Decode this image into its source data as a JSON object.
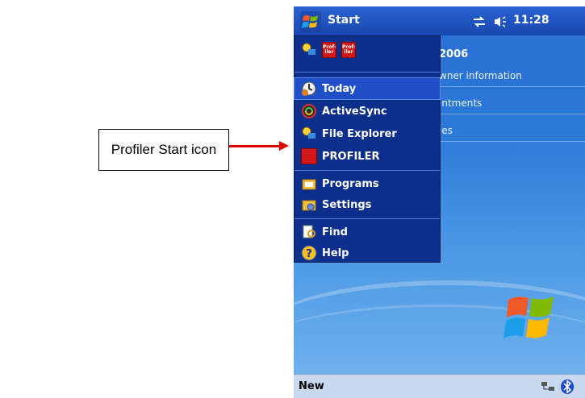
{
  "annotation": {
    "label": "Profiler Start icon",
    "arrow_color": "#e00000"
  },
  "titlebar": {
    "start_label": "Start",
    "clock": "11:28"
  },
  "today": {
    "date_fragment": "2006",
    "rows": [
      "wner information",
      "intments",
      "ies"
    ]
  },
  "menu": {
    "recent_icons": [
      "Prof-iler",
      "Prof-iler"
    ],
    "items": [
      {
        "label": "Today",
        "icon": "today-icon"
      },
      {
        "label": "ActiveSync",
        "icon": "activesync-icon"
      },
      {
        "label": "File Explorer",
        "icon": "file-explorer-icon"
      },
      {
        "label": "PROFILER",
        "icon": "profiler-icon"
      },
      {
        "label": "Programs",
        "icon": "programs-icon"
      },
      {
        "label": "Settings",
        "icon": "settings-icon"
      },
      {
        "label": "Find",
        "icon": "find-icon"
      },
      {
        "label": "Help",
        "icon": "help-icon"
      }
    ],
    "selected": "Today"
  },
  "bottombar": {
    "left_softkey": "New"
  },
  "colors": {
    "titlebar": "#1f56c2",
    "menu_bg": "#0c2f8c",
    "menu_selected": "#2050c8",
    "profiler_red": "#d01818"
  }
}
